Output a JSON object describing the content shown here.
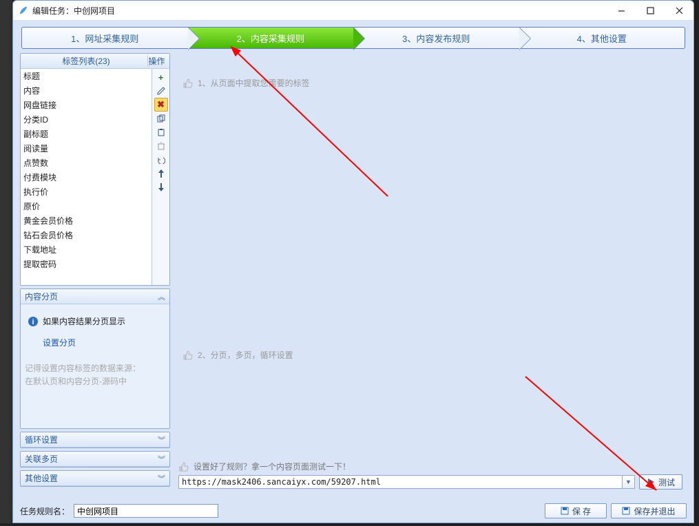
{
  "window_title": "编辑任务：中创网项目",
  "steps": [
    {
      "label": "1、网址采集规则",
      "active": false
    },
    {
      "label": "2、内容采集规则",
      "active": true
    },
    {
      "label": "3、内容发布规则",
      "active": false
    },
    {
      "label": "4、其他设置",
      "active": false
    }
  ],
  "taglist": {
    "header": "标签列表(23)",
    "op_header": "操作",
    "items": [
      "标题",
      "内容",
      "网盘链接",
      "分类ID",
      "副标题",
      "阅读量",
      "点赞数",
      "付费模块",
      "执行价",
      "原价",
      "黄金会员价格",
      "钻石会员价格",
      "下载地址",
      "提取密码"
    ]
  },
  "content_paging": {
    "header": "内容分页",
    "info_text": "如果内容结果分页显示",
    "link_text": "设置分页",
    "note_line1": "记得设置内容标签的数据来源：",
    "note_line2": "在默认页和内容分页-源码中"
  },
  "collapsed_panels": {
    "loop": "循环设置",
    "multipage": "关联多页",
    "other": "其他设置"
  },
  "hints": {
    "h1": "1、从页面中提取您需要的标签",
    "h2": "2、分页，多页，循环设置",
    "h3": "设置好了规则？拿一个内容页面测试一下！"
  },
  "url_value": "https://mask2406.sancaiyx.com/59207.html",
  "test_btn": "测试",
  "footer": {
    "label": "任务规则名：",
    "name_value": "中创网项目",
    "save": "保 存",
    "save_exit": "保存并退出"
  }
}
